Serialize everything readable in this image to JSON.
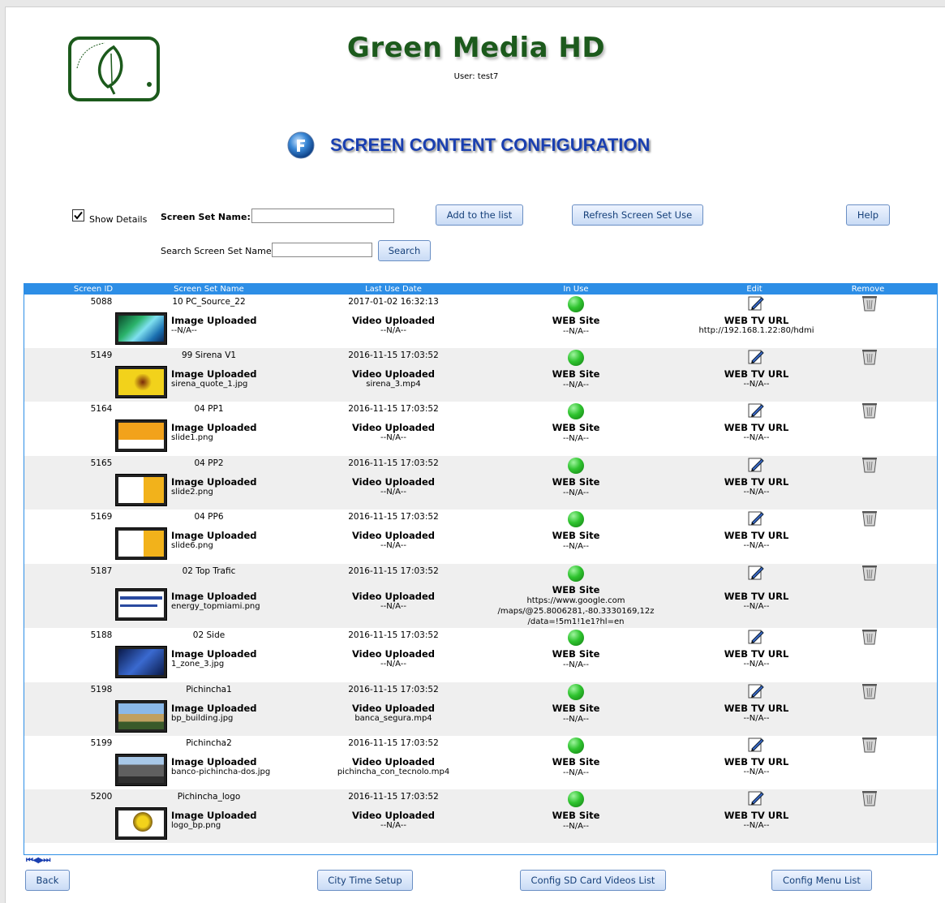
{
  "brand": {
    "title": "Green Media HD",
    "user": "User: test7"
  },
  "section_title": "SCREEN CONTENT CONFIGURATION",
  "controls": {
    "show_details_label": "Show Details",
    "show_details_checked": true,
    "screen_set_name_label": "Screen Set Name:",
    "screen_set_name_value": "",
    "add_button": "Add to the list",
    "refresh_button": "Refresh Screen Set Use",
    "help_button": "Help",
    "search_label": "Search Screen Set Name:",
    "search_value": "",
    "search_button": "Search"
  },
  "table": {
    "columns": [
      "Screen ID",
      "Screen Set Name",
      "Last Use Date",
      "In Use",
      "Edit",
      "Remove"
    ],
    "rows": [
      {
        "id": "5088",
        "name": "10 PC_Source_22",
        "date": "2017-01-02 16:32:13",
        "img_label": "Image Uploaded",
        "img_file": "--N/A--",
        "vid_label": "Video Uploaded",
        "vid_file": "--N/A--",
        "web_label": "WEB Site",
        "web_value": "--N/A--",
        "tv_label": "WEB TV URL",
        "tv_value": "http://192.168.1.22:80/hdmi",
        "thumb": "vista"
      },
      {
        "id": "5149",
        "name": "99 Sirena V1",
        "date": "2016-11-15 17:03:52",
        "img_label": "Image Uploaded",
        "img_file": "sirena_quote_1.jpg",
        "vid_label": "Video Uploaded",
        "vid_file": "sirena_3.mp4",
        "web_label": "WEB Site",
        "web_value": "--N/A--",
        "tv_label": "WEB TV URL",
        "tv_value": "--N/A--",
        "thumb": "yellow"
      },
      {
        "id": "5164",
        "name": "04 PP1",
        "date": "2016-11-15 17:03:52",
        "img_label": "Image Uploaded",
        "img_file": "slide1.png",
        "vid_label": "Video Uploaded",
        "vid_file": "--N/A--",
        "web_label": "WEB Site",
        "web_value": "--N/A--",
        "tv_label": "WEB TV URL",
        "tv_value": "--N/A--",
        "thumb": "orange"
      },
      {
        "id": "5165",
        "name": "04 PP2",
        "date": "2016-11-15 17:03:52",
        "img_label": "Image Uploaded",
        "img_file": "slide2.png",
        "vid_label": "Video Uploaded",
        "vid_file": "--N/A--",
        "web_label": "WEB Site",
        "web_value": "--N/A--",
        "tv_label": "WEB TV URL",
        "tv_value": "--N/A--",
        "thumb": "slide"
      },
      {
        "id": "5169",
        "name": "04 PP6",
        "date": "2016-11-15 17:03:52",
        "img_label": "Image Uploaded",
        "img_file": "slide6.png",
        "vid_label": "Video Uploaded",
        "vid_file": "--N/A--",
        "web_label": "WEB Site",
        "web_value": "--N/A--",
        "tv_label": "WEB TV URL",
        "tv_value": "--N/A--",
        "thumb": "slide"
      },
      {
        "id": "5187",
        "name": "02 Top Trafic",
        "date": "2016-11-15 17:03:52",
        "img_label": "Image Uploaded",
        "img_file": "energy_topmiami.png",
        "vid_label": "Video Uploaded",
        "vid_file": "--N/A--",
        "web_label": "WEB Site",
        "web_value": "https://www.google.com\n/maps/@25.8006281,-80.3330169,12z\n/data=!5m1!1e1?hl=en",
        "tv_label": "WEB TV URL",
        "tv_value": "--N/A--",
        "thumb": "text"
      },
      {
        "id": "5188",
        "name": "02 Side",
        "date": "2016-11-15 17:03:52",
        "img_label": "Image Uploaded",
        "img_file": "1_zone_3.jpg",
        "vid_label": "Video Uploaded",
        "vid_file": "--N/A--",
        "web_label": "WEB Site",
        "web_value": "--N/A--",
        "tv_label": "WEB TV URL",
        "tv_value": "--N/A--",
        "thumb": "blue"
      },
      {
        "id": "5198",
        "name": "Pichincha1",
        "date": "2016-11-15 17:03:52",
        "img_label": "Image Uploaded",
        "img_file": "bp_building.jpg",
        "vid_label": "Video Uploaded",
        "vid_file": "banca_segura.mp4",
        "web_label": "WEB Site",
        "web_value": "--N/A--",
        "tv_label": "WEB TV URL",
        "tv_value": "--N/A--",
        "thumb": "building"
      },
      {
        "id": "5199",
        "name": "Pichincha2",
        "date": "2016-11-15 17:03:52",
        "img_label": "Image Uploaded",
        "img_file": "banco-pichincha-dos.jpg",
        "vid_label": "Video Uploaded",
        "vid_file": "pichincha_con_tecnolo.mp4",
        "web_label": "WEB Site",
        "web_value": "--N/A--",
        "tv_label": "WEB TV URL",
        "tv_value": "--N/A--",
        "thumb": "building2"
      },
      {
        "id": "5200",
        "name": "Pichincha_logo",
        "date": "2016-11-15 17:03:52",
        "img_label": "Image Uploaded",
        "img_file": "logo_bp.png",
        "vid_label": "Video Uploaded",
        "vid_file": "--N/A--",
        "web_label": "WEB Site",
        "web_value": "--N/A--",
        "tv_label": "WEB TV URL",
        "tv_value": "--N/A--",
        "thumb": "logo"
      }
    ]
  },
  "pager": "⏮◀▶⏭",
  "footer": {
    "back": "Back",
    "city": "City Time Setup",
    "sd": "Config SD Card Videos List",
    "menu": "Config Menu List"
  },
  "colors": {
    "brand": "#1c5a1c",
    "title": "#1a3fb0",
    "header": "#2d8ee6",
    "in_use": "#2fc42f"
  }
}
